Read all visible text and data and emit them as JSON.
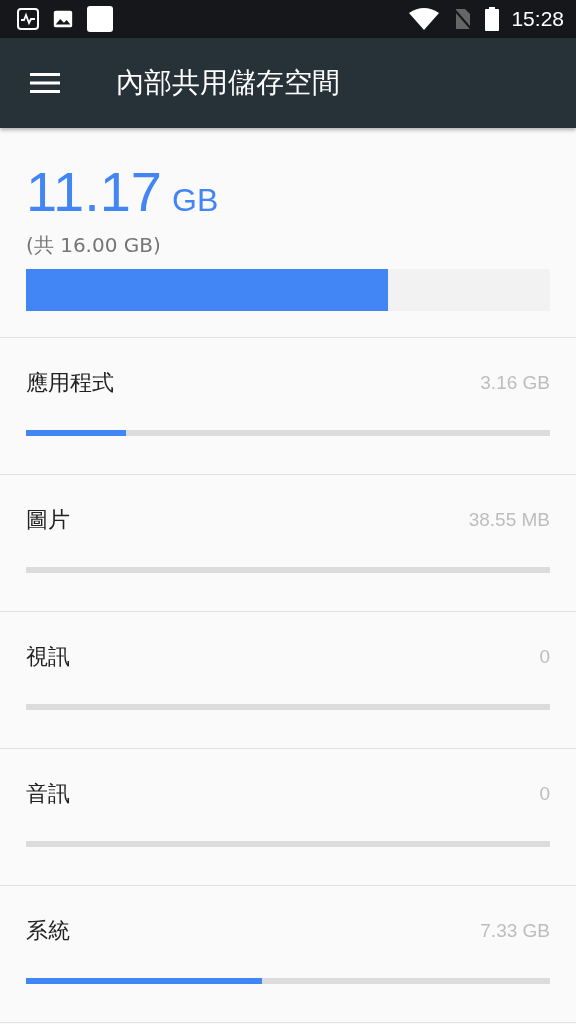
{
  "status_bar": {
    "time": "15:28"
  },
  "toolbar": {
    "title": "內部共用儲存空間"
  },
  "summary": {
    "used": "11.17",
    "unit": "GB",
    "total": "(共 16.00 GB)",
    "level": 0.69
  },
  "categories": [
    {
      "name": "應用程式",
      "size": "3.16 GB",
      "level": 0.19
    },
    {
      "name": "圖片",
      "size": "38.55 MB"
    },
    {
      "name": "視訊",
      "size": "0"
    },
    {
      "name": "音訊",
      "size": "0"
    },
    {
      "name": "系統",
      "size": "7.33 GB",
      "level": 0.45
    }
  ]
}
